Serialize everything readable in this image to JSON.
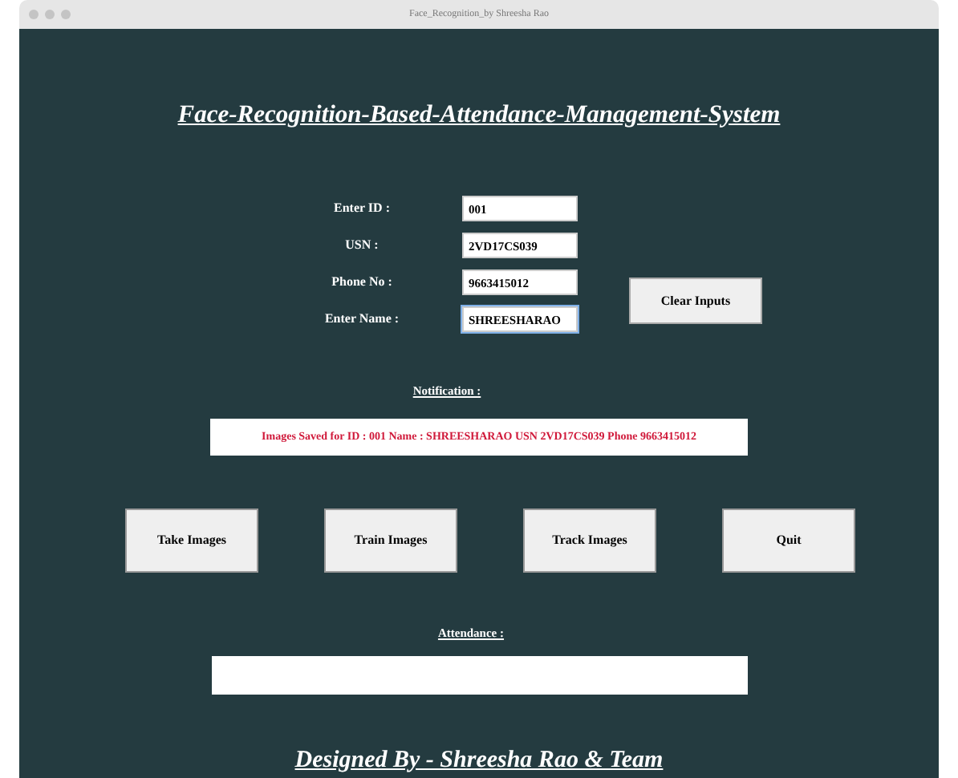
{
  "window": {
    "title": "Face_Recognition_by Shreesha Rao"
  },
  "heading": "Face-Recognition-Based-Attendance-Management-System",
  "fields": [
    {
      "label": "Enter ID :",
      "value": "001",
      "focused": false
    },
    {
      "label": "USN :",
      "value": "2VD17CS039",
      "focused": false
    },
    {
      "label": "Phone No :",
      "value": "9663415012",
      "focused": false
    },
    {
      "label": "Enter Name :",
      "value": "SHREESHARAO",
      "focused": true
    }
  ],
  "clear_button": "Clear Inputs",
  "notification": {
    "label": "Notification :",
    "message": "Images Saved for ID : 001 Name : SHREESHARAO USN 2VD17CS039 Phone 9663415012"
  },
  "buttons": [
    "Take Images",
    "Train Images",
    "Track Images",
    "Quit"
  ],
  "attendance": {
    "label": "Attendance :"
  },
  "footer": "Designed By - Shreesha Rao & Team"
}
